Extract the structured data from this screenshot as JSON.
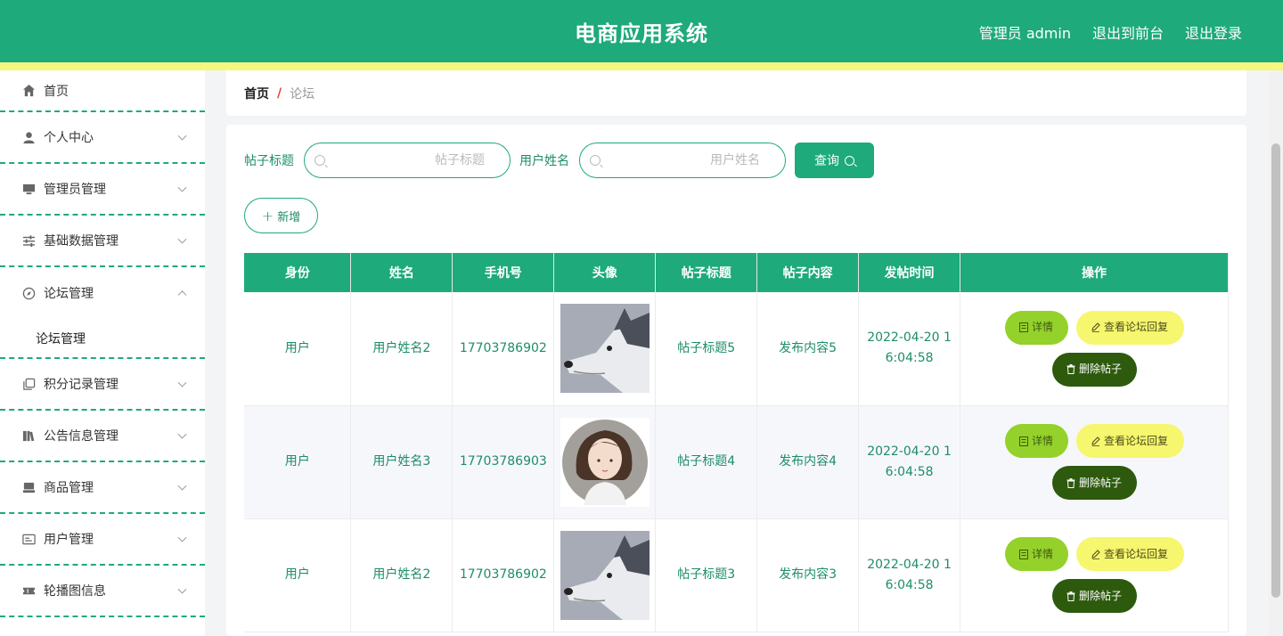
{
  "header": {
    "title": "电商应用系统",
    "user": "管理员 admin",
    "to_front": "退出到前台",
    "logout": "退出登录"
  },
  "sidebar": {
    "items": [
      {
        "label": "首页",
        "icon": "home-icon"
      },
      {
        "label": "个人中心",
        "icon": "user-icon"
      },
      {
        "label": "管理员管理",
        "icon": "monitor-icon"
      },
      {
        "label": "基础数据管理",
        "icon": "sliders-icon"
      },
      {
        "label": "论坛管理",
        "icon": "compass-icon"
      },
      {
        "label": "积分记录管理",
        "icon": "copy-icon"
      },
      {
        "label": "公告信息管理",
        "icon": "books-icon"
      },
      {
        "label": "商品管理",
        "icon": "box-icon"
      },
      {
        "label": "用户管理",
        "icon": "id-card-icon"
      },
      {
        "label": "轮播图信息",
        "icon": "ticket-icon"
      }
    ],
    "submenu": "论坛管理"
  },
  "breadcrumb": {
    "home": "首页",
    "sep": "/",
    "current": "论坛"
  },
  "search": {
    "title_label": "帖子标题",
    "title_placeholder": "帖子标题",
    "name_label": "用户姓名",
    "name_placeholder": "用户姓名",
    "query_label": "查询"
  },
  "add_label": "新增",
  "table": {
    "headers": [
      "身份",
      "姓名",
      "手机号",
      "头像",
      "帖子标题",
      "帖子内容",
      "发帖时间",
      "操作"
    ],
    "rows": [
      {
        "role": "用户",
        "name": "用户姓名2",
        "phone": "17703786902",
        "avatar": "dog",
        "title": "帖子标题5",
        "content": "发布内容5",
        "time1": "2022-04-20 1",
        "time2": "6:04:58"
      },
      {
        "role": "用户",
        "name": "用户姓名3",
        "phone": "17703786903",
        "avatar": "girl",
        "title": "帖子标题4",
        "content": "发布内容4",
        "time1": "2022-04-20 1",
        "time2": "6:04:58"
      },
      {
        "role": "用户",
        "name": "用户姓名2",
        "phone": "17703786902",
        "avatar": "dog",
        "title": "帖子标题3",
        "content": "发布内容3",
        "time1": "2022-04-20 1",
        "time2": "6:04:58"
      }
    ],
    "actions": {
      "detail": "详情",
      "reply": "查看论坛回复",
      "delete": "删除帖子"
    }
  },
  "colors": {
    "primary": "#1eaa7b",
    "strip": "#f6f77e",
    "detail": "#95d12b",
    "reply": "#f6f66f",
    "delete": "#2d5a0d"
  }
}
